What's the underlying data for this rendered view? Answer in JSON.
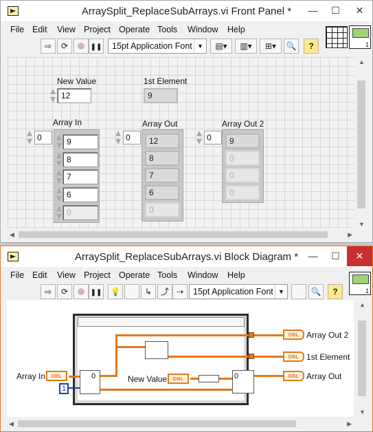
{
  "front_panel": {
    "title": "ArraySplit_ReplaceSubArrays.vi Front Panel *",
    "menu": [
      "File",
      "Edit",
      "View",
      "Project",
      "Operate",
      "Tools",
      "Window",
      "Help"
    ],
    "font_selector": "15pt Application Font",
    "controls": {
      "new_value": {
        "label": "New Value",
        "value": "12"
      },
      "first_element": {
        "label": "1st Element",
        "value": "9"
      },
      "array_in": {
        "label": "Array In",
        "index": "0",
        "values": [
          "9",
          "8",
          "7",
          "6",
          "0"
        ]
      },
      "array_out": {
        "label": "Array Out",
        "index": "0",
        "values": [
          "12",
          "8",
          "7",
          "6",
          "0"
        ]
      },
      "array_out_2": {
        "label": "Array Out 2",
        "index": "0",
        "values": [
          "9",
          "0",
          "0",
          "0"
        ]
      }
    }
  },
  "block_diagram": {
    "title": "ArraySplit_ReplaceSubArrays.vi Block Diagram *",
    "menu": [
      "File",
      "Edit",
      "View",
      "Project",
      "Operate",
      "Tools",
      "Window",
      "Help"
    ],
    "font_selector": "15pt Application Font",
    "terminals": {
      "array_in": "Array In",
      "new_value": "New Value",
      "array_out_2": "Array Out 2",
      "first_element": "1st Element",
      "array_out": "Array Out",
      "dbl": "DBL"
    },
    "constant_value": "1",
    "node_zero": "0"
  },
  "icons": {
    "arrow": "run-arrow-icon",
    "continuous": "run-continuous-icon",
    "stop": "abort-icon",
    "pause": "pause-icon",
    "help": "help-icon",
    "search": "search-icon"
  },
  "colors": {
    "wire_orange": "#e07a1b",
    "constant_blue": "#1d3ea0",
    "close_red": "#c7302e"
  },
  "glyphs": {
    "minimize": "—",
    "maximize": "☐",
    "close": "✕",
    "run": "⇨",
    "run_continuous": "⟳",
    "highlight": "💡",
    "step_into": "↳",
    "step_over": "⤴",
    "step_out": "⇢",
    "help": "?",
    "search": "🔍",
    "dropdown": "▼",
    "align": "▤▾",
    "distribute": "▥▾",
    "resize": "⊞▾",
    "reorder": "⇳▾",
    "scroll_up": "▲",
    "scroll_down": "▼",
    "scroll_left": "◀",
    "scroll_right": "▶"
  }
}
